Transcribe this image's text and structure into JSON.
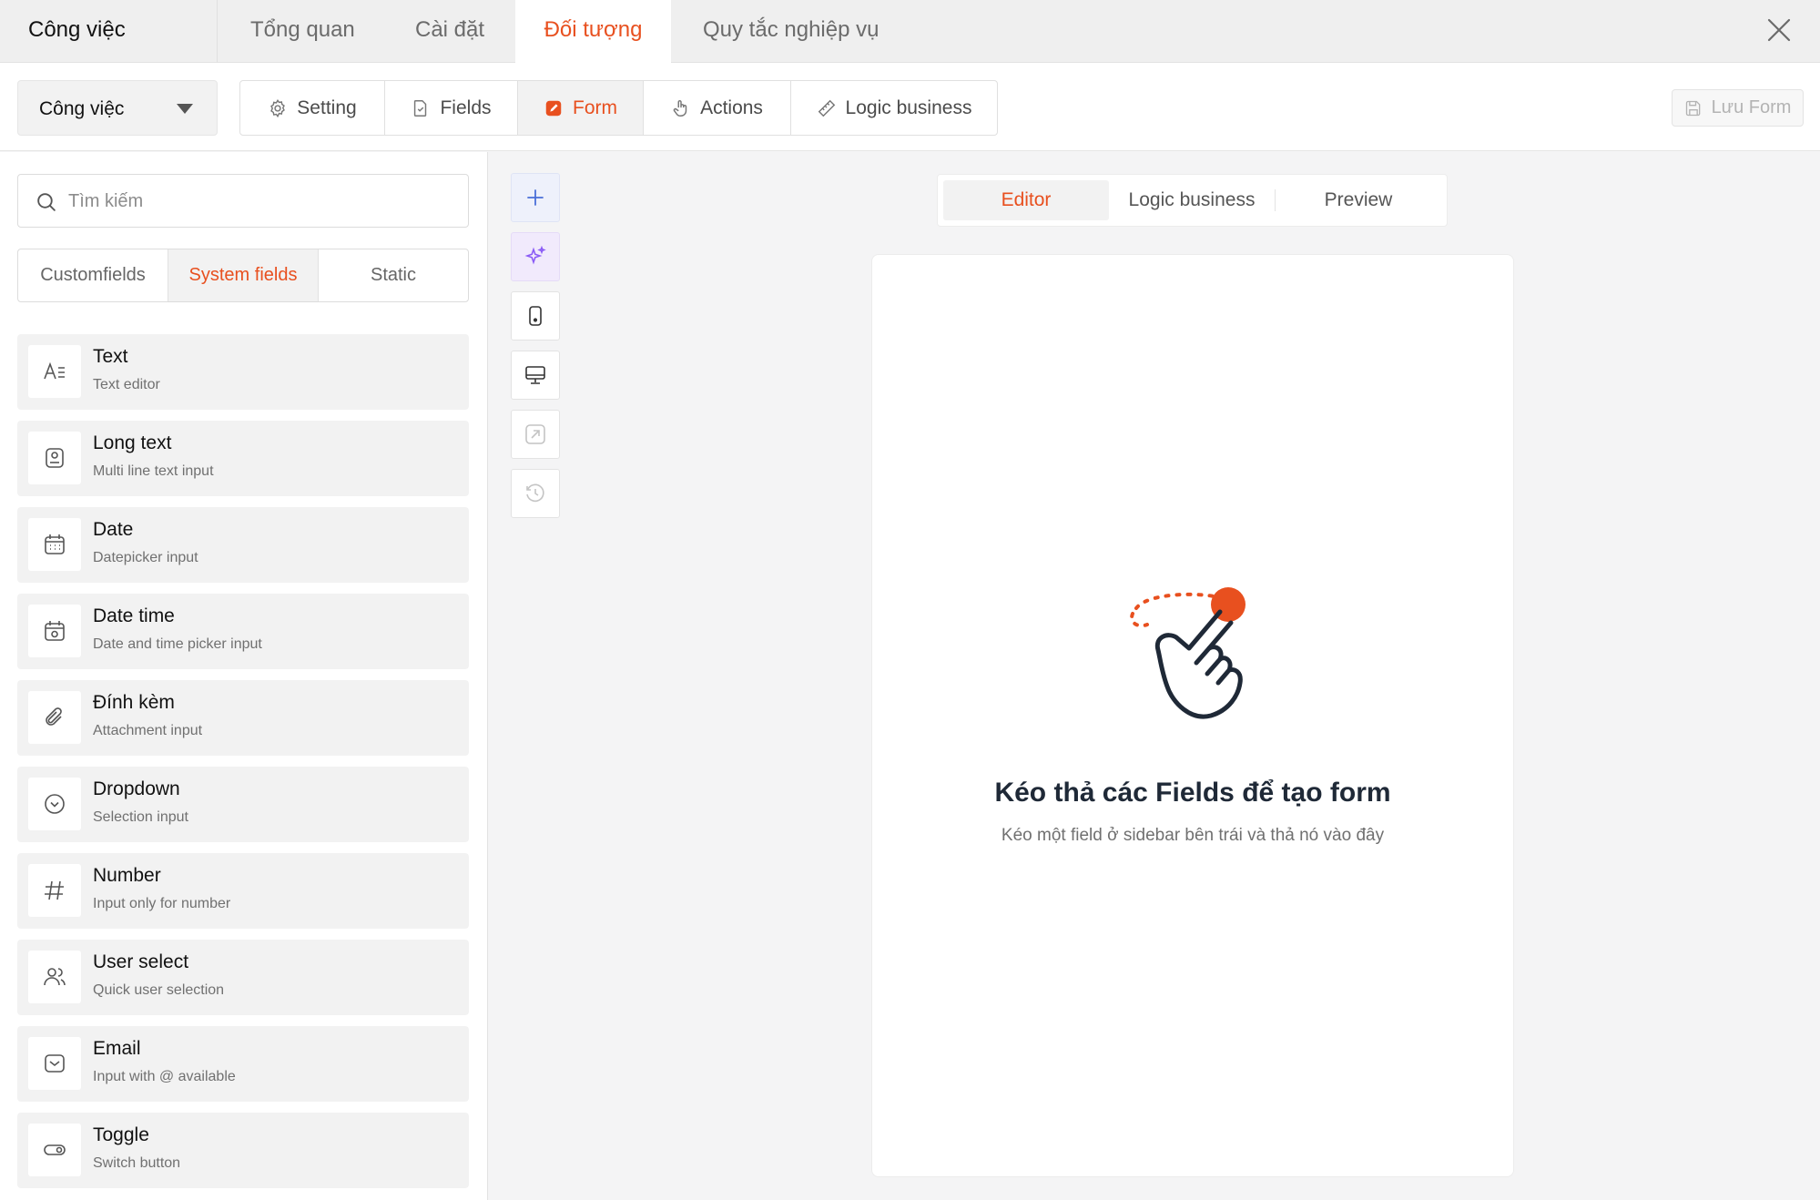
{
  "app": {
    "title": "Công việc",
    "tabs": [
      "Tổng quan",
      "Cài đặt",
      "Đối tượng",
      "Quy tắc nghiệp vụ"
    ],
    "active_tab": "Đối tượng"
  },
  "toolbar": {
    "object_select": "Công việc",
    "segments": [
      {
        "label": "Setting",
        "icon": "gear-icon"
      },
      {
        "label": "Fields",
        "icon": "file-check-icon"
      },
      {
        "label": "Form",
        "icon": "edit-icon"
      },
      {
        "label": "Actions",
        "icon": "pointer-hand-icon"
      },
      {
        "label": "Logic business",
        "icon": "ruler-icon"
      }
    ],
    "active_segment": "Form",
    "save_label": "Lưu Form"
  },
  "sidebar": {
    "search_placeholder": "Tìm kiếm",
    "field_tabs": [
      "Customfields",
      "System fields",
      "Static"
    ],
    "active_field_tab": "System fields",
    "fields": [
      {
        "name": "Text",
        "desc": "Text editor",
        "icon": "text-icon"
      },
      {
        "name": "Long text",
        "desc": "Multi line text input",
        "icon": "long-text-icon"
      },
      {
        "name": "Date",
        "desc": "Datepicker input",
        "icon": "calendar-icon"
      },
      {
        "name": "Date time",
        "desc": "Date and time picker input",
        "icon": "calendar-clock-icon"
      },
      {
        "name": "Đính kèm",
        "desc": "Attachment input",
        "icon": "paperclip-icon"
      },
      {
        "name": "Dropdown",
        "desc": "Selection input",
        "icon": "chevron-circle-icon"
      },
      {
        "name": "Number",
        "desc": "Input only for number",
        "icon": "hash-icon"
      },
      {
        "name": "User select",
        "desc": "Quick user selection",
        "icon": "users-icon"
      },
      {
        "name": "Email",
        "desc": "Input with @ available",
        "icon": "mail-icon"
      },
      {
        "name": "Toggle",
        "desc": "Switch button",
        "icon": "toggle-icon"
      }
    ]
  },
  "tools": [
    "plus-icon",
    "sparkle-icon",
    "mobile-icon",
    "desktop-icon",
    "external-link-icon",
    "history-icon"
  ],
  "editor": {
    "tabs": [
      "Editor",
      "Logic business",
      "Preview"
    ],
    "active_tab": "Editor",
    "empty_title": "Kéo thả các Fields để tạo form",
    "empty_subtitle": "Kéo một field ở sidebar bên trái và thả nó vào đây"
  },
  "colors": {
    "accent": "#e8501f",
    "panel_bg": "#f2f2f2"
  }
}
